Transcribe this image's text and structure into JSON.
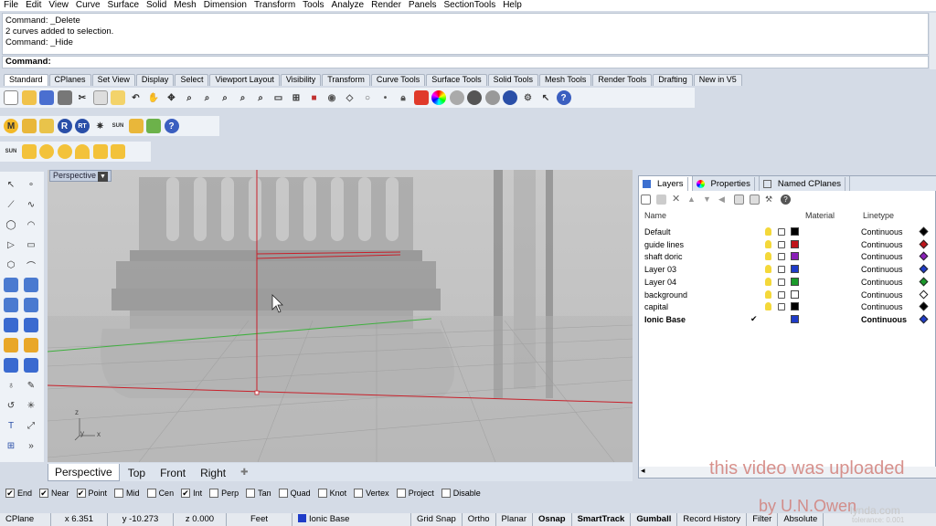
{
  "menu": [
    "File",
    "Edit",
    "View",
    "Curve",
    "Surface",
    "Solid",
    "Mesh",
    "Dimension",
    "Transform",
    "Tools",
    "Analyze",
    "Render",
    "Panels",
    "SectionTools",
    "Help"
  ],
  "command_history": [
    "Command: _Delete",
    "2 curves added to selection.",
    "Command: _Hide"
  ],
  "command_prompt": "Command:",
  "toolbar_tabs": [
    "Standard",
    "CPlanes",
    "Set View",
    "Display",
    "Select",
    "Viewport Layout",
    "Visibility",
    "Transform",
    "Curve Tools",
    "Surface Tools",
    "Solid Tools",
    "Mesh Tools",
    "Render Tools",
    "Drafting",
    "New in V5"
  ],
  "sun_label": "SUN",
  "viewport": {
    "title": "Perspective",
    "axes": {
      "z": "z",
      "y": "y",
      "x": "x"
    }
  },
  "view_tabs": [
    "Perspective",
    "Top",
    "Front",
    "Right"
  ],
  "panel": {
    "tabs": [
      "Layers",
      "Properties",
      "Named CPlanes"
    ],
    "columns": {
      "name": "Name",
      "material": "Material",
      "linetype": "Linetype"
    },
    "layers": [
      {
        "name": "Default",
        "color": "#000000",
        "linetype": "Continuous"
      },
      {
        "name": "guide lines",
        "color": "#c0141a",
        "linetype": "Continuous"
      },
      {
        "name": "shaft doric",
        "color": "#8a1fb8",
        "linetype": "Continuous"
      },
      {
        "name": "Layer 03",
        "color": "#1f3cc8",
        "linetype": "Continuous"
      },
      {
        "name": "Layer 04",
        "color": "#1a9a2a",
        "linetype": "Continuous"
      },
      {
        "name": "background",
        "color": "#ffffff",
        "linetype": "Continuous"
      },
      {
        "name": "capital",
        "color": "#000000",
        "linetype": "Continuous"
      },
      {
        "name": "Ionic Base",
        "color": "#1f3cc8",
        "linetype": "Continuous",
        "current": true
      }
    ]
  },
  "osnaps": [
    {
      "label": "End",
      "checked": true
    },
    {
      "label": "Near",
      "checked": true
    },
    {
      "label": "Point",
      "checked": true
    },
    {
      "label": "Mid",
      "checked": false
    },
    {
      "label": "Cen",
      "checked": false
    },
    {
      "label": "Int",
      "checked": true
    },
    {
      "label": "Perp",
      "checked": false
    },
    {
      "label": "Tan",
      "checked": false
    },
    {
      "label": "Quad",
      "checked": false
    },
    {
      "label": "Knot",
      "checked": false
    },
    {
      "label": "Vertex",
      "checked": false
    },
    {
      "label": "Project",
      "checked": false
    },
    {
      "label": "Disable",
      "checked": false
    }
  ],
  "status": {
    "cplane": "CPlane",
    "x": "x 6.351",
    "y": "y -10.273",
    "z": "z 0.000",
    "units": "Feet",
    "layer": "Ionic Base",
    "toggles": [
      "Grid Snap",
      "Ortho",
      "Planar",
      "Osnap",
      "SmartTrack",
      "Gumball",
      "Record History",
      "Filter",
      "Absolute"
    ],
    "tolerance": "tolerance: 0.001"
  },
  "watermark": {
    "line1": "this video was uploaded",
    "line2": "by U.N.Owen",
    "brand": "lynda.com"
  }
}
